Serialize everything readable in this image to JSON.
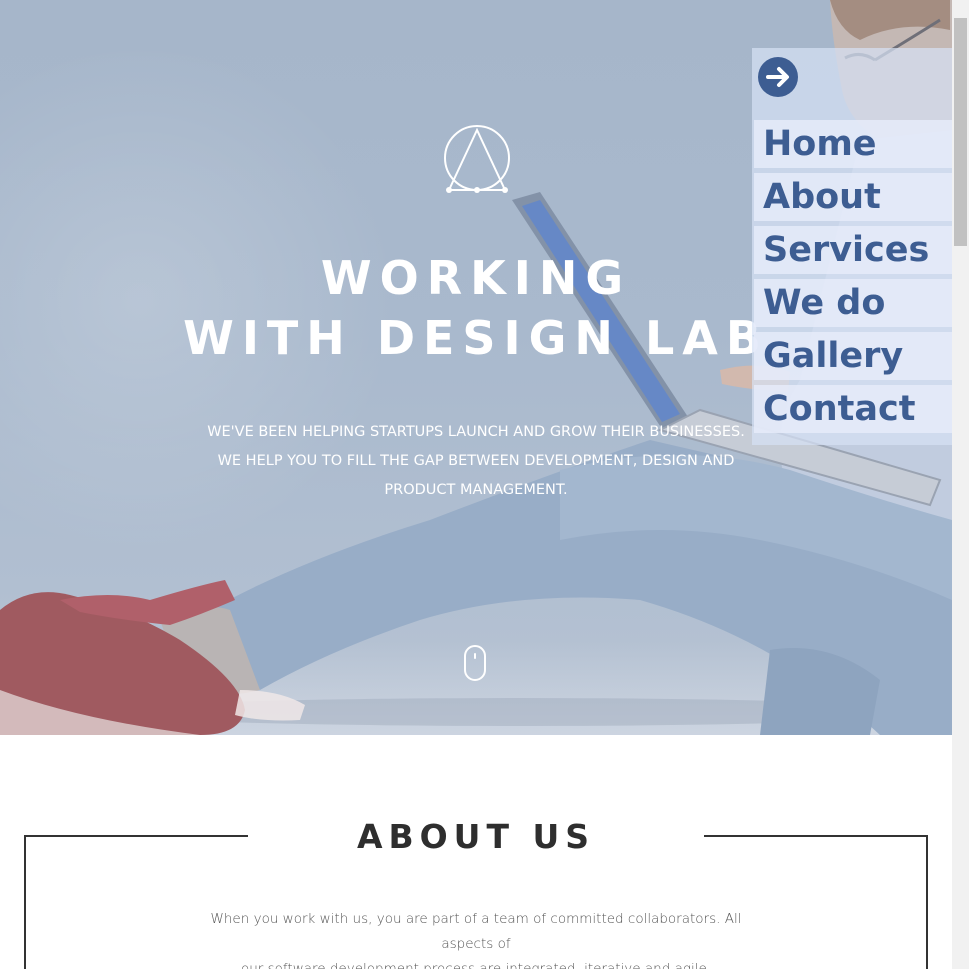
{
  "hero": {
    "title_line1": "WORKING",
    "title_line2": "WITH DESIGN LAB",
    "subtitle_line1": "WE'VE BEEN HELPING STARTUPS LAUNCH AND GROW THEIR BUSINESSES.",
    "subtitle_line2": "WE HELP YOU TO FILL THE GAP BETWEEN DEVELOPMENT, DESIGN AND",
    "subtitle_line3": "PRODUCT MANAGEMENT.",
    "logo_icon": "triangle-circle-logo-icon",
    "scroll_icon": "mouse-scroll-icon"
  },
  "nav": {
    "toggle_icon": "arrow-right-icon",
    "items": [
      {
        "label": "Home"
      },
      {
        "label": "About"
      },
      {
        "label": "Services"
      },
      {
        "label": "We do"
      },
      {
        "label": "Gallery"
      },
      {
        "label": "Contact"
      }
    ]
  },
  "about": {
    "title": "ABOUT US",
    "text_line1": "When you work with us, you are part of a team of committed collaborators. All aspects of",
    "text_line2": "our software development process are integrated, iterative and agile."
  },
  "colors": {
    "accent": "#3d5d92",
    "hero_overlay": "#a9b9cd",
    "dark_text": "#2e2e2e"
  }
}
